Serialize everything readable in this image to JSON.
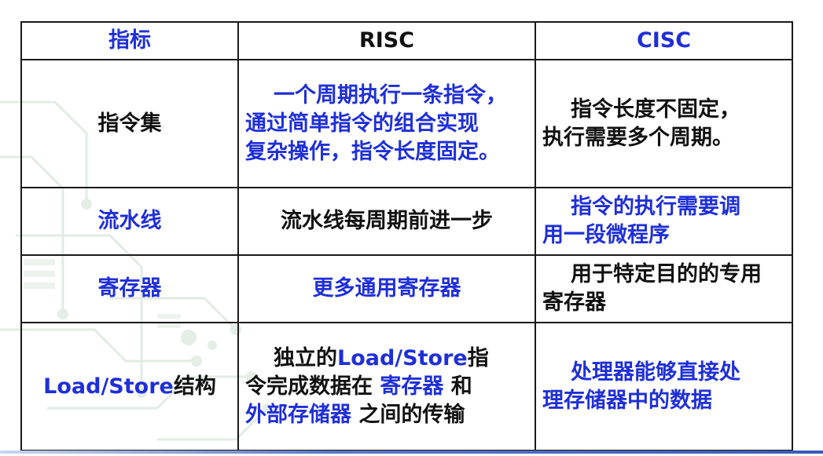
{
  "table": {
    "headers": [
      "指标",
      "RISC",
      "CISC"
    ],
    "rows": [
      {
        "label": "指令集",
        "risc": {
          "lines": [
            "一个周期执行一条指令，",
            "通过简单指令的组合实现",
            "复杂操作，指令长度固定。"
          ]
        },
        "cisc": {
          "lines": [
            "指令长度不固定，",
            "执行需要多个周期。"
          ]
        }
      },
      {
        "label": "流水线",
        "risc": {
          "text": "流水线每周期前进一步"
        },
        "cisc": {
          "lines": [
            "指令的执行需要调",
            "用一段微程序"
          ]
        }
      },
      {
        "label": "寄存器",
        "risc": {
          "text": "更多通用寄存器"
        },
        "cisc": {
          "lines": [
            "用于特定目的的专用",
            "寄存器"
          ]
        }
      },
      {
        "label_part1": "Load/Store",
        "label_part2": "结构",
        "risc": {
          "line1_a": "独立的",
          "line1_b": "Load/Store",
          "line1_c": "指",
          "line2_a": "令完成数据在 ",
          "line2_b": "寄存器",
          "line2_c": " 和",
          "line3_a": "外部存储器",
          "line3_b": " 之间的传输"
        },
        "cisc": {
          "lines": [
            "处理器能够直接处",
            "理存储器中的数据"
          ]
        }
      }
    ]
  },
  "colors": {
    "blue": "#1f2fd8",
    "black": "#111111",
    "accent_line": "#3a5ab8"
  }
}
